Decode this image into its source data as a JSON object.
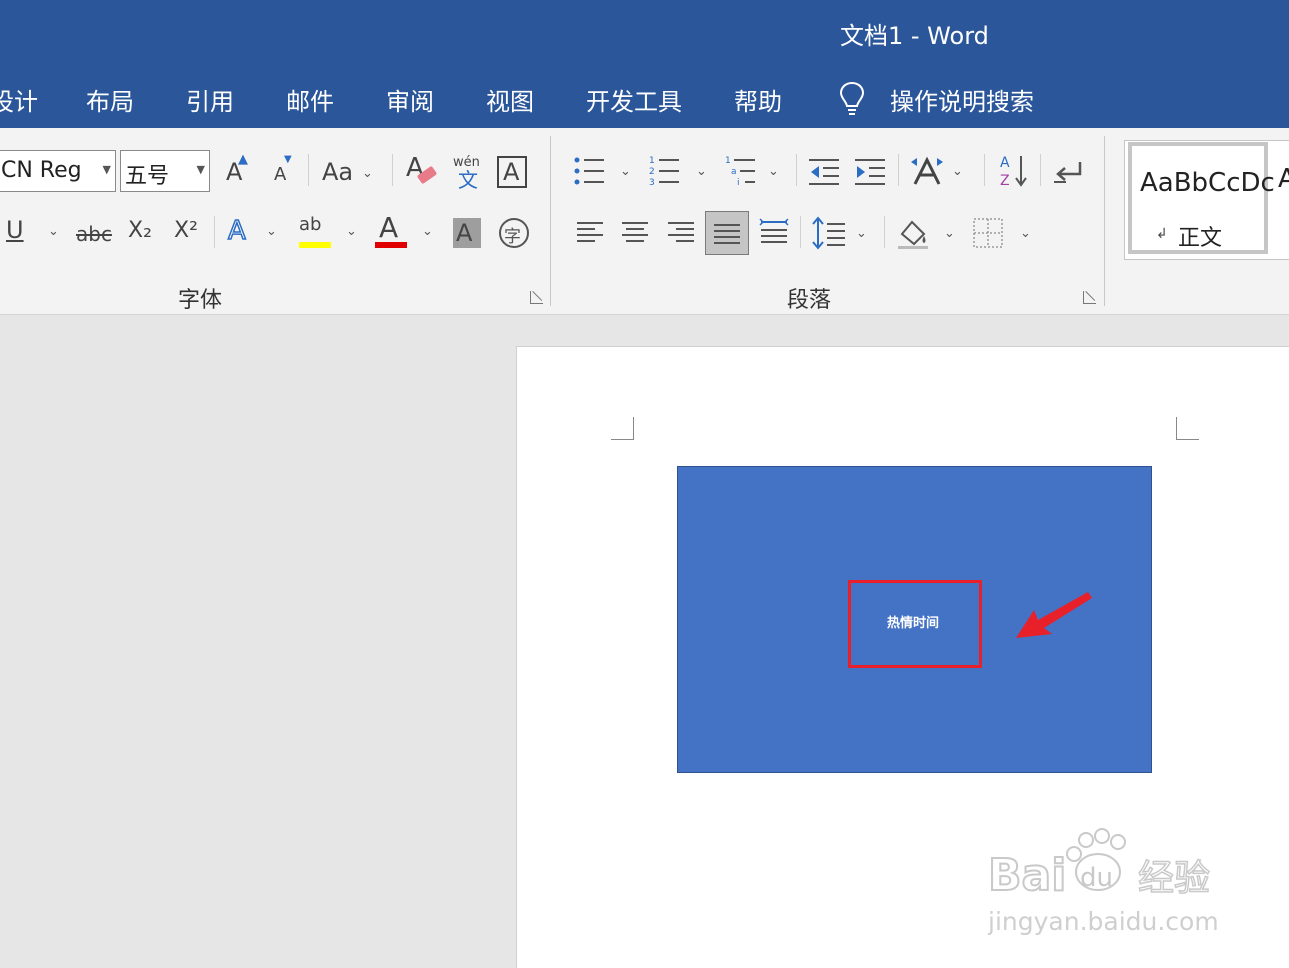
{
  "window": {
    "title": "文档1  -  Word"
  },
  "tabs": [
    {
      "label": "设计"
    },
    {
      "label": "布局"
    },
    {
      "label": "引用"
    },
    {
      "label": "邮件"
    },
    {
      "label": "审阅"
    },
    {
      "label": "视图"
    },
    {
      "label": "开发工具"
    },
    {
      "label": "帮助"
    }
  ],
  "search": {
    "label": "操作说明搜索"
  },
  "font": {
    "group_label": "字体",
    "font_name": "CN Reg",
    "font_size": "五号",
    "grow_label": "A",
    "shrink_label": "A",
    "case_label": "Aa",
    "phonetic_top": "wén",
    "phonetic_bottom": "文",
    "border_char": "A",
    "underline_label": "U",
    "strike_label": "abc",
    "subscript_label": "X₂",
    "superscript_label": "X²",
    "effects_label": "A",
    "highlight_label": "ab",
    "color_label": "A",
    "shading_label": "A",
    "enclose_label": "字",
    "highlight_color": "#ffff00",
    "font_color": "#e00000"
  },
  "paragraph": {
    "group_label": "段落"
  },
  "styles": {
    "sample_text": "AaBbCcDc",
    "style_name": "正文",
    "next_sample": "A"
  },
  "document": {
    "box_text": "热情时间",
    "box_color": "#4472c4"
  },
  "watermark": {
    "brand_text": "Bai",
    "brand_text2": "du",
    "brand_cn": "经验",
    "site": "jingyan.baidu.com"
  },
  "colors": {
    "ribbon_blue": "#2b579a",
    "annotation_red": "#e8202a"
  }
}
